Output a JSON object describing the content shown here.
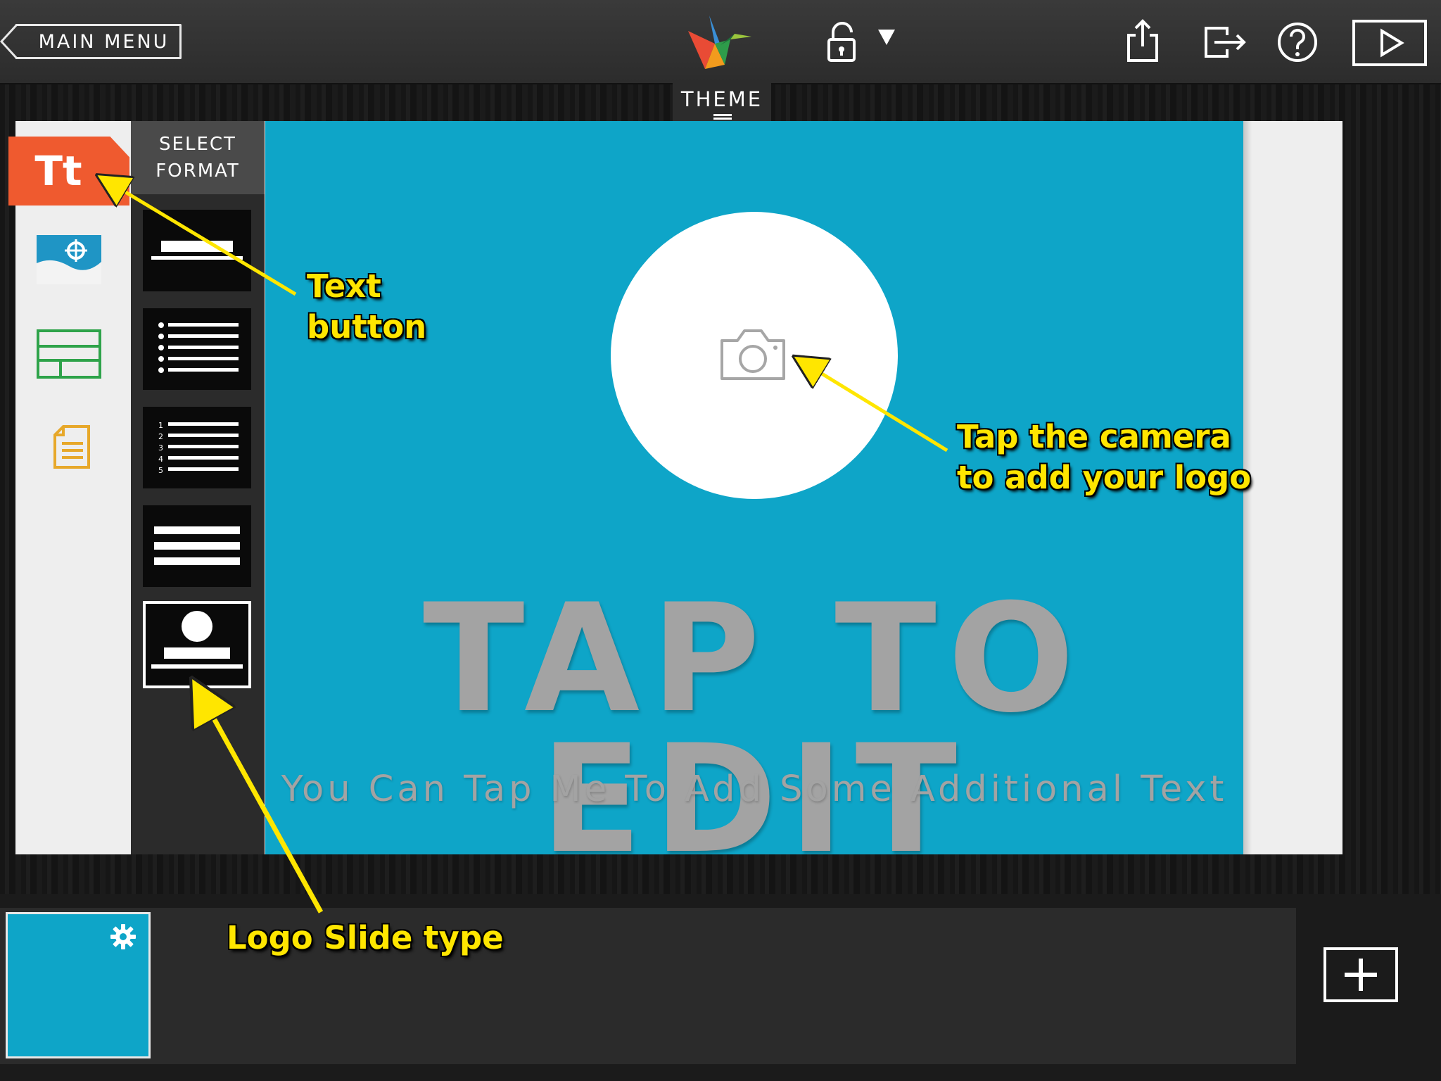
{
  "toolbar": {
    "main_menu_label": "MAIN MENU",
    "icons": [
      "app-logo",
      "lock-icon",
      "share-icon",
      "exit-icon",
      "help-icon",
      "play-icon"
    ]
  },
  "theme_tab": {
    "label": "THEME"
  },
  "sidebar": {
    "text_button_label": "Tt",
    "items": [
      "text",
      "image",
      "layout",
      "notes"
    ]
  },
  "format_panel": {
    "header_line1": "SELECT",
    "header_line2": "FORMAT",
    "formats": [
      "title",
      "bullet-list",
      "numbered-list",
      "paragraph",
      "logo-slide"
    ],
    "selected": "logo-slide"
  },
  "slide": {
    "title": "TAP TO EDIT",
    "subtitle": "You Can Tap Me To Add Some Additional Text",
    "background_color": "#0ea5c8"
  },
  "numbered_list_numbers": [
    "1",
    "2",
    "3",
    "4",
    "5"
  ],
  "annotations": {
    "text_button_line1": "Text",
    "text_button_line2": "button",
    "camera_line1": "Tap the camera",
    "camera_line2": "to add your logo",
    "logo_slide": "Logo Slide type",
    "color": "#ffe600"
  },
  "colors": {
    "accent_orange": "#ef5a2f",
    "slide_blue": "#0ea5c8",
    "text_gray": "#a3a3a3"
  }
}
